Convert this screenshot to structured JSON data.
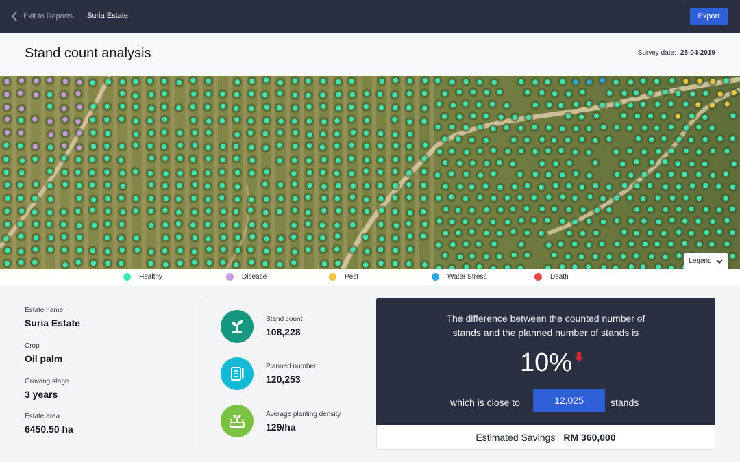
{
  "topbar": {
    "back_label": "Exit to Reports",
    "breadcrumb": "Suria Estate",
    "export_label": "Export"
  },
  "header": {
    "title": "Stand count analysis",
    "survey_label": "Survey date:",
    "survey_date": "25-04-2019"
  },
  "map": {
    "zoom_in": "+",
    "zoom_out": "−",
    "legend_label": "Legend"
  },
  "legend": [
    {
      "label": "Healthy",
      "color": "#3fe6b0"
    },
    {
      "label": "Disease",
      "color": "#c99ae0"
    },
    {
      "label": "Pest",
      "color": "#f5c342"
    },
    {
      "label": "Water Stress",
      "color": "#2fa8e6"
    },
    {
      "label": "Death",
      "color": "#e84848"
    }
  ],
  "estate": [
    {
      "label": "Estate name",
      "value": "Suria Estate"
    },
    {
      "label": "Crop",
      "value": "Oil palm"
    },
    {
      "label": "Growing stage",
      "value": "3 years"
    },
    {
      "label": "Estate area",
      "value": "6450.50 ha"
    }
  ],
  "stats": [
    {
      "label": "Stand count",
      "value": "108,228",
      "icon": "sprout-icon",
      "color": "#14987f"
    },
    {
      "label": "Planned number",
      "value": "120,253",
      "icon": "notebook-icon",
      "color": "#13b9d6"
    },
    {
      "label": "Average planting density",
      "value": "129/ha",
      "icon": "planter-icon",
      "color": "#7cc242"
    }
  ],
  "difference": {
    "text_line1": "The difference between the counted number of",
    "text_line2": "stands and the planned number of stands is",
    "percent": "10%",
    "close_label": "which is close to",
    "close_value": "12,025",
    "stands_label": "stands",
    "arrow_color": "#d0262e"
  },
  "savings": {
    "label": "Estimated Savings",
    "value": "RM 360,000"
  }
}
